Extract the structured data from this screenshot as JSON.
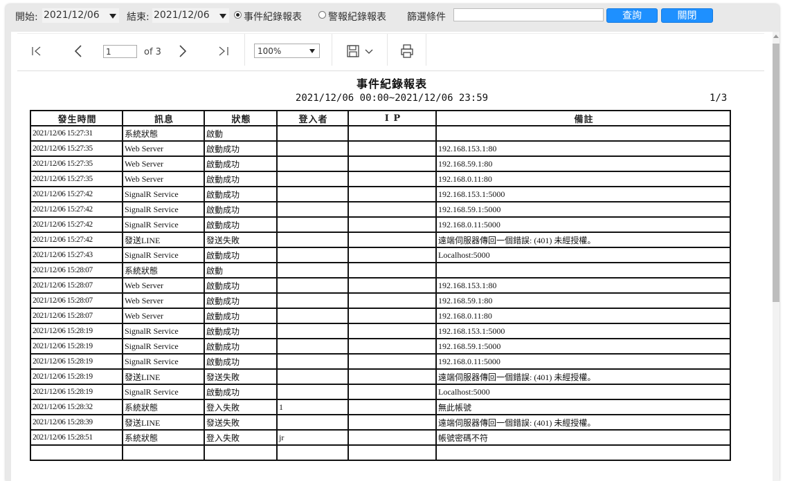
{
  "filter": {
    "start_label": "開始:",
    "start_value": "2021/12/06",
    "end_label": "結束:",
    "end_value": "2021/12/06",
    "radio_event": "事件紀錄報表",
    "radio_alarm": "警報紀錄報表",
    "filter_label": "篩選條件",
    "filter_value": "",
    "query_button": "查詢",
    "close_button": "關閉"
  },
  "toolbar": {
    "page_current": "1",
    "page_of": "of 3",
    "zoom": "100%"
  },
  "report": {
    "title": "事件紀錄報表",
    "range": "2021/12/06 00:00~2021/12/06 23:59",
    "page_indicator": "1/3",
    "columns": [
      "發生時間",
      "訊息",
      "狀態",
      "登入者",
      "I P",
      "備註"
    ],
    "rows": [
      {
        "time": "2021/12/06 15:27:31",
        "msg": "系統狀態",
        "status": "啟動",
        "user": "",
        "ip": "",
        "note": ""
      },
      {
        "time": "2021/12/06 15:27:35",
        "msg": "Web Server",
        "status": "啟動成功",
        "user": "",
        "ip": "",
        "note": "192.168.153.1:80"
      },
      {
        "time": "2021/12/06 15:27:35",
        "msg": "Web Server",
        "status": "啟動成功",
        "user": "",
        "ip": "",
        "note": "192.168.59.1:80"
      },
      {
        "time": "2021/12/06 15:27:35",
        "msg": "Web Server",
        "status": "啟動成功",
        "user": "",
        "ip": "",
        "note": "192.168.0.11:80"
      },
      {
        "time": "2021/12/06 15:27:42",
        "msg": "SignalR Service",
        "status": "啟動成功",
        "user": "",
        "ip": "",
        "note": "192.168.153.1:5000"
      },
      {
        "time": "2021/12/06 15:27:42",
        "msg": "SignalR Service",
        "status": "啟動成功",
        "user": "",
        "ip": "",
        "note": "192.168.59.1:5000"
      },
      {
        "time": "2021/12/06 15:27:42",
        "msg": "SignalR Service",
        "status": "啟動成功",
        "user": "",
        "ip": "",
        "note": "192.168.0.11:5000"
      },
      {
        "time": "2021/12/06 15:27:42",
        "msg": "發送LINE",
        "status": "發送失敗",
        "user": "",
        "ip": "",
        "note": "遠端伺服器傳回一個錯誤: (401) 未經授權。"
      },
      {
        "time": "2021/12/06 15:27:43",
        "msg": "SignalR Service",
        "status": "啟動成功",
        "user": "",
        "ip": "",
        "note": "Localhost:5000"
      },
      {
        "time": "2021/12/06 15:28:07",
        "msg": "系統狀態",
        "status": "啟動",
        "user": "",
        "ip": "",
        "note": ""
      },
      {
        "time": "2021/12/06 15:28:07",
        "msg": "Web Server",
        "status": "啟動成功",
        "user": "",
        "ip": "",
        "note": "192.168.153.1:80"
      },
      {
        "time": "2021/12/06 15:28:07",
        "msg": "Web Server",
        "status": "啟動成功",
        "user": "",
        "ip": "",
        "note": "192.168.59.1:80"
      },
      {
        "time": "2021/12/06 15:28:07",
        "msg": "Web Server",
        "status": "啟動成功",
        "user": "",
        "ip": "",
        "note": "192.168.0.11:80"
      },
      {
        "time": "2021/12/06 15:28:19",
        "msg": "SignalR Service",
        "status": "啟動成功",
        "user": "",
        "ip": "",
        "note": "192.168.153.1:5000"
      },
      {
        "time": "2021/12/06 15:28:19",
        "msg": "SignalR Service",
        "status": "啟動成功",
        "user": "",
        "ip": "",
        "note": "192.168.59.1:5000"
      },
      {
        "time": "2021/12/06 15:28:19",
        "msg": "SignalR Service",
        "status": "啟動成功",
        "user": "",
        "ip": "",
        "note": "192.168.0.11:5000"
      },
      {
        "time": "2021/12/06 15:28:19",
        "msg": "發送LINE",
        "status": "發送失敗",
        "user": "",
        "ip": "",
        "note": "遠端伺服器傳回一個錯誤: (401) 未經授權。"
      },
      {
        "time": "2021/12/06 15:28:19",
        "msg": "SignalR Service",
        "status": "啟動成功",
        "user": "",
        "ip": "",
        "note": "Localhost:5000"
      },
      {
        "time": "2021/12/06 15:28:32",
        "msg": "系統狀態",
        "status": "登入失敗",
        "user": "1",
        "ip": "",
        "note": "無此帳號"
      },
      {
        "time": "2021/12/06 15:28:39",
        "msg": "發送LINE",
        "status": "發送失敗",
        "user": "",
        "ip": "",
        "note": "遠端伺服器傳回一個錯誤: (401) 未經授權。"
      },
      {
        "time": "2021/12/06 15:28:51",
        "msg": "系統狀態",
        "status": "登入失敗",
        "user": "jr",
        "ip": "",
        "note": "帳號密碼不符"
      },
      {
        "time": "",
        "msg": "",
        "status": "",
        "user": "",
        "ip": "",
        "note": ""
      }
    ]
  }
}
